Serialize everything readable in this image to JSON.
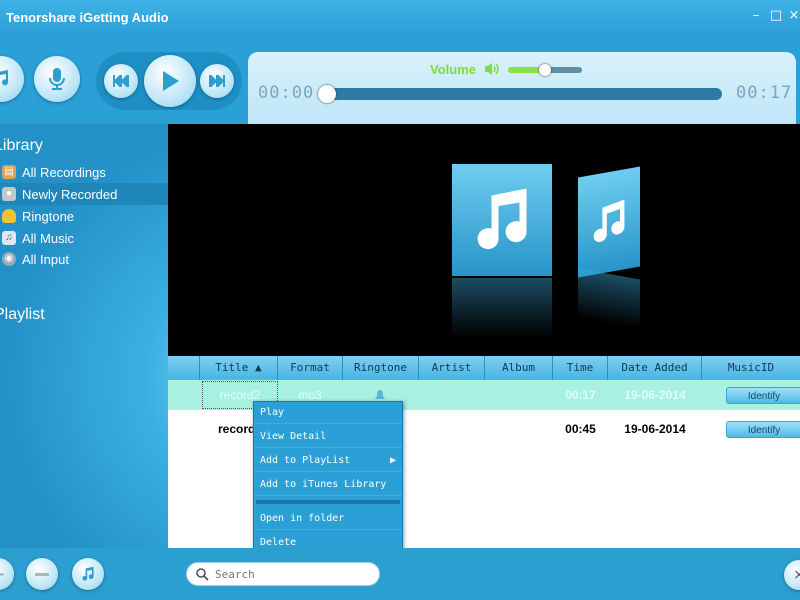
{
  "window": {
    "title": "Tenorshare iGetting Audio",
    "controls": {
      "minimize": "–",
      "restore": "□",
      "close": "×"
    }
  },
  "player": {
    "volume_label": "Volume",
    "elapsed": "00:00",
    "total": "00:17",
    "volume_level": 0.5,
    "seek_position": 0.0
  },
  "sidebar": {
    "library_heading": "Library",
    "items": [
      {
        "label": "All Recordings",
        "icon": "recordings-icon"
      },
      {
        "label": "Newly Recorded",
        "icon": "new-record-icon"
      },
      {
        "label": "Ringtone",
        "icon": "bell-icon"
      },
      {
        "label": "All Music",
        "icon": "music-icon"
      },
      {
        "label": "All Input",
        "icon": "input-icon"
      }
    ],
    "playlist_heading": "Playlist"
  },
  "table": {
    "columns": [
      "Title",
      "Format",
      "Ringtone",
      "Artist",
      "Album",
      "Time",
      "Date Added",
      "MusicID"
    ],
    "rows": [
      {
        "title": "record2",
        "format": "mp3",
        "time": "00:17",
        "date": "19-06-2014",
        "action": "Identify"
      },
      {
        "title": "record3",
        "format": "",
        "time": "00:45",
        "date": "19-06-2014",
        "action": "Identify"
      }
    ]
  },
  "context_menu": {
    "items": [
      "Play",
      "View Detail",
      "Add to PlayList",
      "Add to iTunes Library",
      "Open in folder",
      "Delete"
    ]
  },
  "search": {
    "placeholder": "Search"
  },
  "colors": {
    "accent": "#2aa0d6",
    "volume_green": "#7fdc3a",
    "selected_row": "#a8f0e0"
  }
}
